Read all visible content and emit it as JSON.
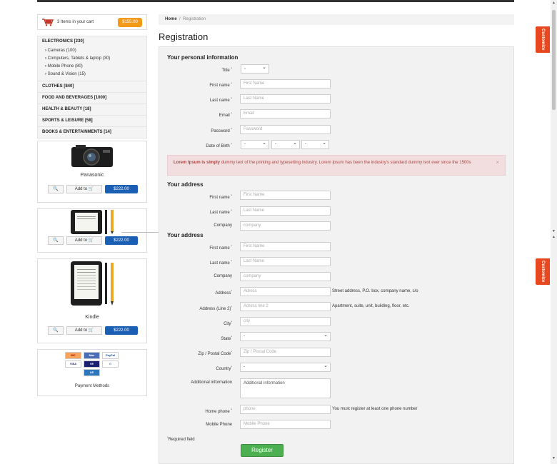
{
  "cart": {
    "text": "3 Items in your cart",
    "price": "$155.00"
  },
  "categories": [
    {
      "label": "ELECTRONICS [230]",
      "subs": [
        "Cameras (100)",
        "Computers, Tablets & laptop (30)",
        "Mobile Phone (80)",
        "Sound & Vision (15)"
      ]
    },
    {
      "label": "CLOTHES [840]"
    },
    {
      "label": "FOOD AND BEVERAGES [1000]"
    },
    {
      "label": "HEALTH & BEAUTY [18]"
    },
    {
      "label": "SPORTS & LEISURE [58]"
    },
    {
      "label": "BOOKS & ENTERTAINMENTS [14]"
    }
  ],
  "products": [
    {
      "name": "Panasonic",
      "add": "Add to",
      "price": "$222.00",
      "zoom": "🔍"
    },
    {
      "name": "",
      "add": "Add to",
      "price": "$222.00",
      "zoom": "🔍"
    },
    {
      "name": "Kindle",
      "add": "Add to",
      "price": "$222.00",
      "zoom": "🔍"
    }
  ],
  "payment": {
    "label": "Payment Methods",
    "cards": [
      "MasterCard",
      "Maestro",
      "PayPal",
      "VISA",
      "VISA Electron",
      "Google",
      "AmEx"
    ]
  },
  "breadcrumb": {
    "home": "Home",
    "sep": "/",
    "current": "Registration"
  },
  "page_title": "Registration",
  "sections": {
    "personal": "Your personal information",
    "address1": "Your address",
    "address2": "Your address"
  },
  "fields": {
    "title": {
      "label": "Title",
      "value": "-"
    },
    "first_name": {
      "label": "First name",
      "placeholder": "First Name"
    },
    "last_name": {
      "label": "Last name",
      "placeholder": "Last Name"
    },
    "email": {
      "label": "Email",
      "placeholder": "Email"
    },
    "password": {
      "label": "Password",
      "placeholder": "Password"
    },
    "dob": {
      "label": "Date of Birth",
      "day": "-",
      "month": "-",
      "year": "-"
    },
    "a1_first": {
      "label": "First name",
      "placeholder": "First Name"
    },
    "a1_last": {
      "label": "Last name",
      "placeholder": "Last Name"
    },
    "a1_company": {
      "label": "Company",
      "placeholder": "company"
    },
    "a2_first": {
      "label": "First name",
      "placeholder": "First Name"
    },
    "a2_last": {
      "label": "Last name",
      "placeholder": "Last Name"
    },
    "a2_company": {
      "label": "Company",
      "placeholder": "company"
    },
    "address": {
      "label": "Address",
      "placeholder": "Adress",
      "hint": "Street address, P.O. box, company name, c/o"
    },
    "address2": {
      "label": "Address (Line 2)",
      "placeholder": "Adress line 2",
      "hint": "Apartment, suite, unit, building, floor, etc."
    },
    "city": {
      "label": "City",
      "placeholder": "city"
    },
    "state": {
      "label": "State",
      "value": "-"
    },
    "zip": {
      "label": "Zip / Postal Code",
      "placeholder": "Zip / Postal Code"
    },
    "country": {
      "label": "Country",
      "value": "-"
    },
    "additional": {
      "label": "Additional information",
      "value": "Additional information"
    },
    "home_phone": {
      "label": "Home phone",
      "placeholder": "phone",
      "hint": "You must register at least one phone number"
    },
    "mobile": {
      "label": "Mobile Phone",
      "placeholder": "Mobile Phone"
    }
  },
  "alert": {
    "bold": "Lorem Ipsum is simply",
    "text": " dummy text of the printing and typesetting industry. Lorem Ipsum has been the industry's standard dummy text ever since the 1500s",
    "close": "×"
  },
  "required_note": "Required field",
  "register_button": "Register",
  "customize": "Customize",
  "colors": {
    "accent": "#e8481f",
    "price_badge": "#f49a1a",
    "price_button": "#1a5fb4",
    "register": "#4caf50"
  }
}
